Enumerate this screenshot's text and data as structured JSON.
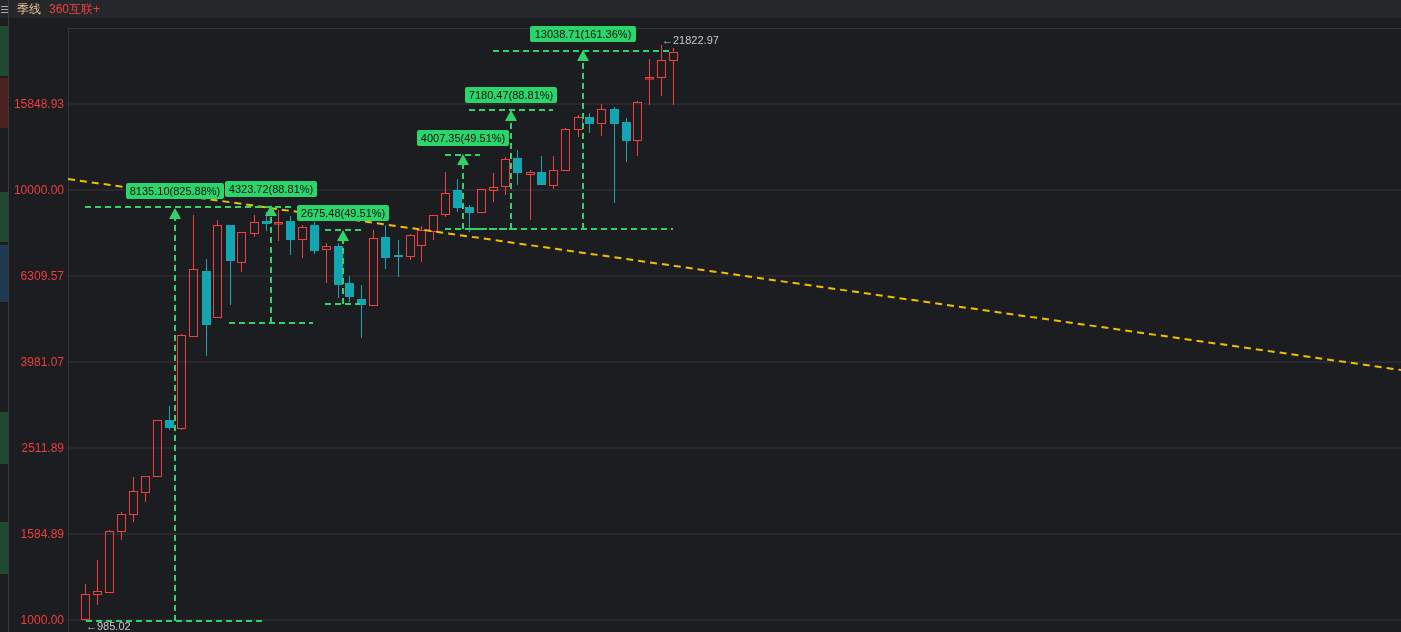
{
  "header": {
    "period": "季线",
    "title": "360互联+"
  },
  "y_axis_labels": [
    "15848.93",
    "10000.00",
    "6309.57",
    "3981.07",
    "2511.89",
    "1584.89",
    "1000.00"
  ],
  "measurements": [
    {
      "label": "8135.10(825.88%)"
    },
    {
      "label": "4323.72(88.81%)"
    },
    {
      "label": "2675.48(49.51%)"
    },
    {
      "label": "4007.35(49.51%)"
    },
    {
      "label": "7180.47(88.81%)"
    },
    {
      "label": "13038.71(161.36%)"
    }
  ],
  "price_markers": {
    "high": "←21822.97",
    "low": "←985.02"
  }
}
